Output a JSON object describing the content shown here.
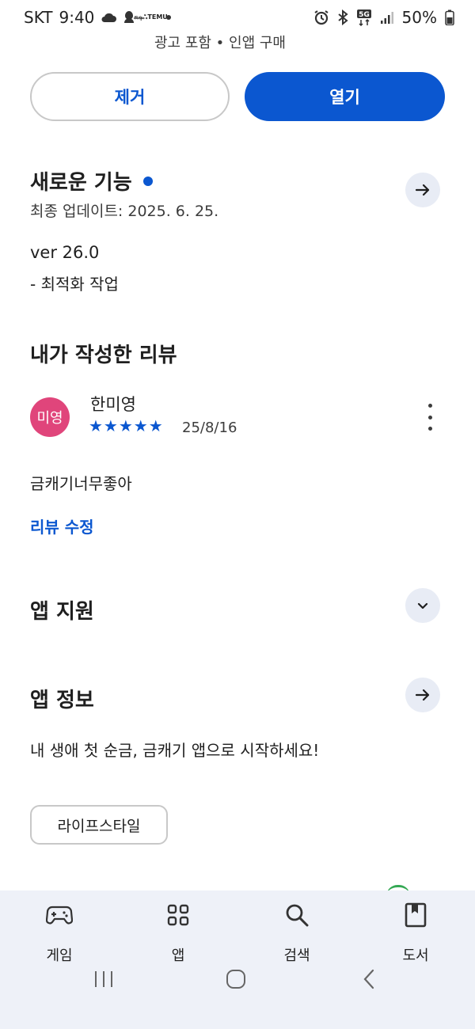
{
  "status_bar": {
    "carrier": "SKT",
    "time": "9:40",
    "temu_top": "க்ஷஃ",
    "temu_bottom": "TEMU",
    "battery": "50%"
  },
  "header": {
    "ad_note": "광고 포함 • 인앱 구매"
  },
  "actions": {
    "remove_label": "제거",
    "open_label": "열기"
  },
  "whats_new": {
    "title": "새로운 기능",
    "last_update": "최종 업데이트: 2025. 6. 25.",
    "version": "ver 26.0",
    "note": "- 최적화 작업"
  },
  "my_review": {
    "title": "내가 작성한 리뷰",
    "avatar_text": "미영",
    "reviewer": "한미영",
    "rating": 5,
    "stars": "★★★★★",
    "date": "25/8/16",
    "text": "금캐기너무좋아",
    "edit_label": "리뷰 수정"
  },
  "app_support": {
    "title": "앱 지원"
  },
  "app_info": {
    "title": "앱 정보",
    "description": "내 생애 첫 순금, 금캐기 앱으로 시작하세요!",
    "category_chip": "라이프스타일"
  },
  "bottom_nav": {
    "items": [
      {
        "label": "게임",
        "icon": "gamepad-icon"
      },
      {
        "label": "앱",
        "icon": "apps-grid-icon"
      },
      {
        "label": "검색",
        "icon": "search-icon"
      },
      {
        "label": "도서",
        "icon": "book-icon"
      }
    ]
  },
  "colors": {
    "accent": "#0b57d0",
    "avatar": "#e0457b",
    "nav_bg": "#eef1f8",
    "round_button_bg": "#e8ecf5"
  }
}
